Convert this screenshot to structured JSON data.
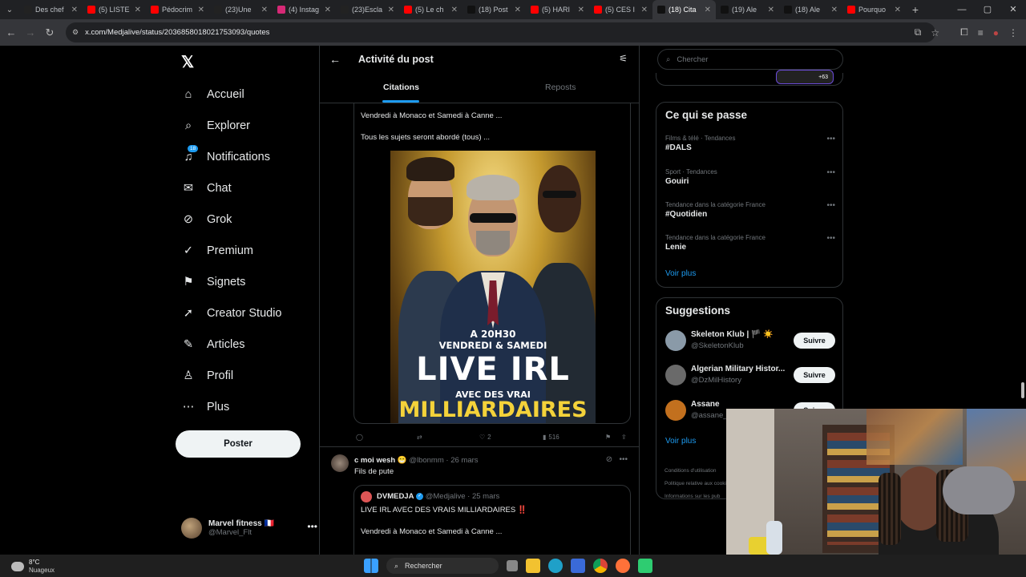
{
  "browser": {
    "tabs": [
      {
        "title": "Des chef",
        "icon": "tiktok-icon",
        "color": "#222"
      },
      {
        "title": "(5) LISTE",
        "icon": "youtube-icon",
        "color": "#ff0000"
      },
      {
        "title": "Pédocrim",
        "icon": "youtube-icon",
        "color": "#ff0000"
      },
      {
        "title": "(23)Une",
        "icon": "tiktok-icon",
        "color": "#222"
      },
      {
        "title": "(4) Instag",
        "icon": "instagram-icon",
        "color": "#d62976"
      },
      {
        "title": "(23)Escla",
        "icon": "tiktok-icon",
        "color": "#222"
      },
      {
        "title": "(5) Le ch",
        "icon": "youtube-icon",
        "color": "#ff0000"
      },
      {
        "title": "(18) Post",
        "icon": "x-icon",
        "color": "#111"
      },
      {
        "title": "(5) HARI",
        "icon": "youtube-icon",
        "color": "#ff0000"
      },
      {
        "title": "(5) CES I",
        "icon": "youtube-icon",
        "color": "#ff0000"
      },
      {
        "title": "(18) Cita",
        "icon": "x-icon",
        "color": "#111"
      },
      {
        "title": "(19) Ale",
        "icon": "x-icon",
        "color": "#111"
      },
      {
        "title": "(18) Ale",
        "icon": "x-icon",
        "color": "#111"
      },
      {
        "title": "Pourquo",
        "icon": "youtube-icon",
        "color": "#ff0000"
      }
    ],
    "url": "x.com/Medjalive/status/2036858018021753093/quotes"
  },
  "nav": {
    "items": [
      {
        "label": "Accueil",
        "icon": "home-icon",
        "glyph": "⌂"
      },
      {
        "label": "Explorer",
        "icon": "search-icon",
        "glyph": "⌕"
      },
      {
        "label": "Notifications",
        "icon": "bell-icon",
        "glyph": "♫",
        "badge": "18"
      },
      {
        "label": "Chat",
        "icon": "mail-icon",
        "glyph": "✉"
      },
      {
        "label": "Grok",
        "icon": "grok-icon",
        "glyph": "⊘"
      },
      {
        "label": "Premium",
        "icon": "verified-icon",
        "glyph": "✓"
      },
      {
        "label": "Signets",
        "icon": "bookmark-icon",
        "glyph": "⚑"
      },
      {
        "label": "Creator Studio",
        "icon": "rocket-icon",
        "glyph": "➚"
      },
      {
        "label": "Articles",
        "icon": "article-icon",
        "glyph": "✎"
      },
      {
        "label": "Profil",
        "icon": "profile-icon",
        "glyph": "♙"
      },
      {
        "label": "Plus",
        "icon": "more-icon",
        "glyph": "⋯"
      }
    ],
    "post_button": "Poster",
    "account": {
      "name": "Marvel fitness 🇫🇷",
      "handle": "@Marvel_Flt"
    }
  },
  "center": {
    "title": "Activité du post",
    "tabs": [
      "Citations",
      "Reposts"
    ],
    "quote_lines": [
      "Vendredi à Monaco et Samedi à Canne ...",
      "Tous les sujets seront abordé (tous) ..."
    ],
    "poster": {
      "line1": "A 20H30",
      "line2": "VENDREDI & SAMEDI",
      "line3": "LIVE IRL",
      "line4": "AVEC DES VRAI",
      "line5": "MILLIARDAIRES"
    },
    "actions": {
      "likes": "2",
      "views": "516"
    },
    "tweet2": {
      "name": "c moi wesh 😁",
      "handle": "@lbonmm",
      "date": "· 26 mars",
      "text": "Fils de pute",
      "quoted": {
        "name": "DVMEDJA",
        "handle": "@Medjalive",
        "date": "· 25 mars",
        "line1": "LIVE IRL AVEC DES VRAIS MILLIARDAIRES ‼️",
        "line2": "Vendredi à Monaco et Samedi à Canne ..."
      }
    }
  },
  "right": {
    "search_placeholder": "Chercher",
    "avatars_count": "+63",
    "trends_title": "Ce qui se passe",
    "trends": [
      {
        "category": "Films & télé · Tendances",
        "name": "#DALS"
      },
      {
        "category": "Sport · Tendances",
        "name": "Gouiri"
      },
      {
        "category": "Tendance dans la catégorie France",
        "name": "#Quotidien"
      },
      {
        "category": "Tendance dans la catégorie France",
        "name": "Lenie"
      }
    ],
    "see_more": "Voir plus",
    "suggestions_title": "Suggestions",
    "suggestions": [
      {
        "name": "Skeleton Klub | 🏴 ☀️",
        "handle": "@SkeletonKlub",
        "color": "#8a9aa8"
      },
      {
        "name": "Algerian Military Histor...",
        "handle": "@DzMilHistory",
        "color": "#6a6a6a"
      },
      {
        "name": "Assane",
        "handle": "@assane_",
        "color": "#c2701e"
      }
    ],
    "follow_label": "Suivre",
    "see_more2": "Voir plus",
    "legal": [
      "Conditions d'utilisation",
      "Politique relative aux cookies",
      "Informations sur les pub"
    ]
  },
  "taskbar": {
    "temp": "8°C",
    "weather": "Nuageux",
    "search": "Rechercher"
  }
}
